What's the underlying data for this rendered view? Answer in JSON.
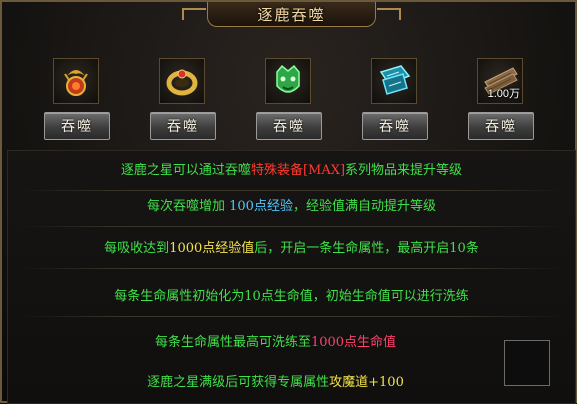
{
  "window": {
    "title": "逐鹿吞噬"
  },
  "items": [
    {
      "icon": "gold-dragon-amulet-icon",
      "button": "吞噬"
    },
    {
      "icon": "golden-ring-icon",
      "button": "吞噬"
    },
    {
      "icon": "jade-beast-mask-icon",
      "button": "吞噬"
    },
    {
      "icon": "cyan-armor-icon",
      "button": "吞噬"
    },
    {
      "icon": "wood-bundle-icon",
      "button": "吞噬",
      "quantity": "1.00万"
    }
  ],
  "info": {
    "line1": {
      "a": "逐鹿之星可以通过吞噬",
      "b": "特殊装备[MAX]",
      "c": "系列物品来提升等级"
    },
    "line2": {
      "a": "每次吞噬增加 ",
      "b": "100点经验",
      "c": "，经验值满自动提升等级"
    },
    "line3": {
      "a": "每吸收达到",
      "b": "1000点经验值",
      "c": "后，开启一条生命属性，最高开启10条"
    },
    "line4": {
      "a": "每条生命属性初始化为10点生命值，初始生命值可以进行洗练"
    },
    "line5": {
      "a": "每条生命属性最高可洗练至",
      "b": "1000点生命值"
    },
    "line6": {
      "a": "逐鹿之星满级后可获得专属属性",
      "b": "攻魔道+100"
    }
  },
  "colors": {
    "green": "#3fe04a",
    "red": "#ff3b2f",
    "cyan": "#4fc7ff",
    "yellow": "#f2e34a",
    "pink": "#ff3f6d",
    "frame": "#6b5a3a"
  }
}
